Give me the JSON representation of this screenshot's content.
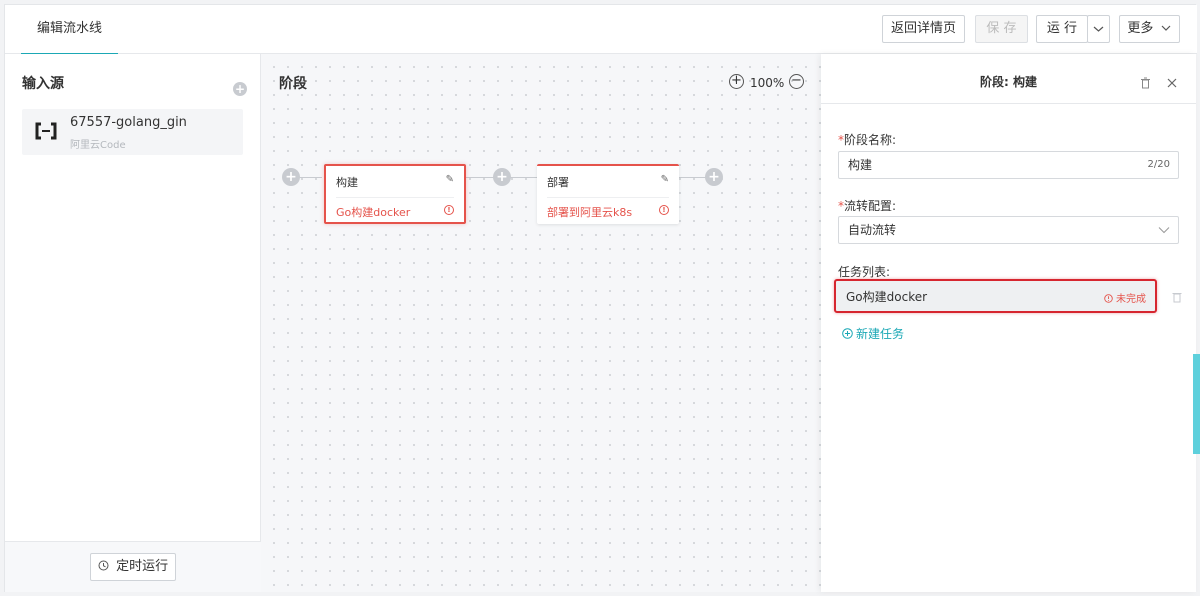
{
  "header": {
    "tab": "编辑流水线",
    "back_label": "返回详情页",
    "save_label": "保 存",
    "run_label": "运 行",
    "more_label": "更多"
  },
  "sources": {
    "title": "输入源",
    "items": [
      {
        "name": "67557-golang_gin",
        "provider": "阿里云Code",
        "icon": "aliyun-logo-icon"
      }
    ],
    "schedule_label": "定时运行"
  },
  "canvas": {
    "title": "阶段",
    "zoom": "100%",
    "stages": [
      {
        "name": "构建",
        "task": "Go构建docker",
        "selected": true
      },
      {
        "name": "部署",
        "task": "部署到阿里云k8s",
        "selected": false
      }
    ]
  },
  "panel": {
    "title": "阶段: 构建",
    "name_label": "阶段名称:",
    "name_value": "构建",
    "name_count": "2/20",
    "flow_label": "流转配置:",
    "flow_value": "自动流转",
    "tasks_label": "任务列表:",
    "tasks": [
      {
        "name": "Go构建docker",
        "status": "未完成"
      }
    ],
    "new_task_label": "新建任务"
  },
  "colors": {
    "accent": "#1ba8b5",
    "error": "#e5534b",
    "highlight": "#d6262f"
  }
}
